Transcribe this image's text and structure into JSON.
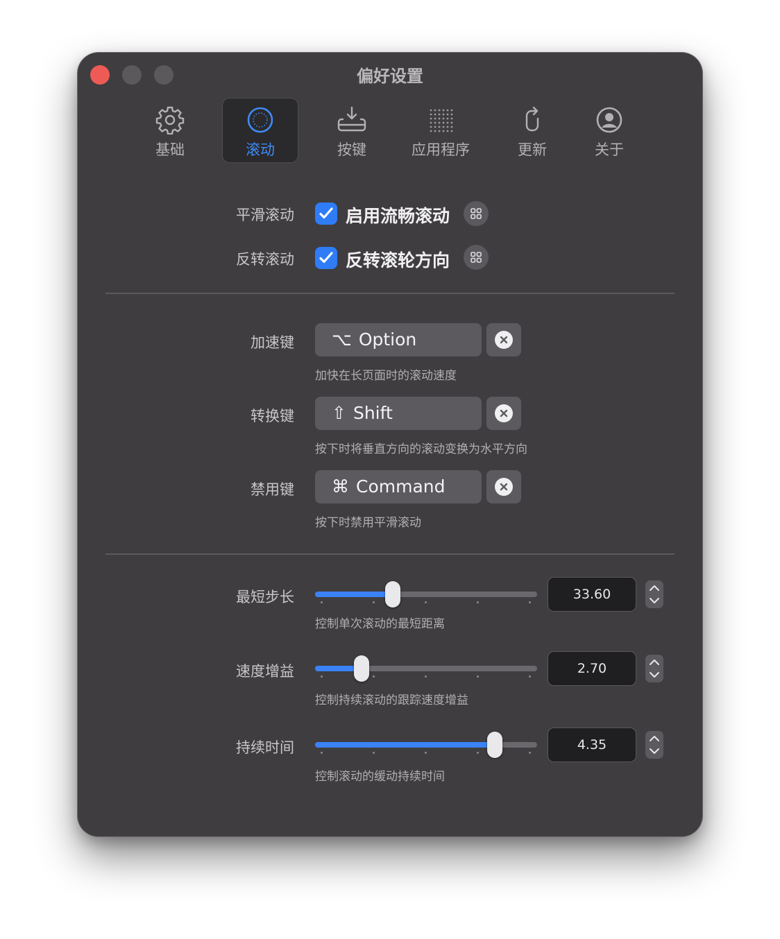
{
  "window": {
    "title": "偏好设置"
  },
  "tabs": [
    {
      "label": "基础",
      "icon": "gear-icon"
    },
    {
      "label": "滚动",
      "icon": "scroll-wheel-icon",
      "active": true
    },
    {
      "label": "按键",
      "icon": "tray-download-icon"
    },
    {
      "label": "应用程序",
      "icon": "dot-grid-icon"
    },
    {
      "label": "更新",
      "icon": "refresh-icon"
    },
    {
      "label": "关于",
      "icon": "person-circle-icon"
    }
  ],
  "toggles": {
    "smooth": {
      "label": "平滑滚动",
      "checkbox_text": "启用流畅滚动",
      "checked": true
    },
    "reverse": {
      "label": "反转滚动",
      "checkbox_text": "反转滚轮方向",
      "checked": true
    }
  },
  "hotkeys": {
    "accelerate": {
      "label": "加速键",
      "glyph": "⌥",
      "key": "Option",
      "hint": "加快在长页面时的滚动速度"
    },
    "convert": {
      "label": "转换键",
      "glyph": "⇧",
      "key": "Shift",
      "hint": "按下时将垂直方向的滚动变换为水平方向"
    },
    "disable": {
      "label": "禁用键",
      "glyph": "⌘",
      "key": "Command",
      "hint": "按下时禁用平滑滚动"
    }
  },
  "sliders": {
    "step": {
      "label": "最短步长",
      "value": "33.60",
      "fraction": 0.35,
      "hint": "控制单次滚动的最短距离"
    },
    "speed": {
      "label": "速度增益",
      "value": "2.70",
      "fraction": 0.21,
      "hint": "控制持续滚动的跟踪速度增益"
    },
    "duration": {
      "label": "持续时间",
      "value": "4.35",
      "fraction": 0.81,
      "hint": "控制滚动的缓动持续时间"
    }
  },
  "colors": {
    "accent": "#3a82f6",
    "window_bg": "#3f3d40",
    "close": "#ee5b56"
  }
}
